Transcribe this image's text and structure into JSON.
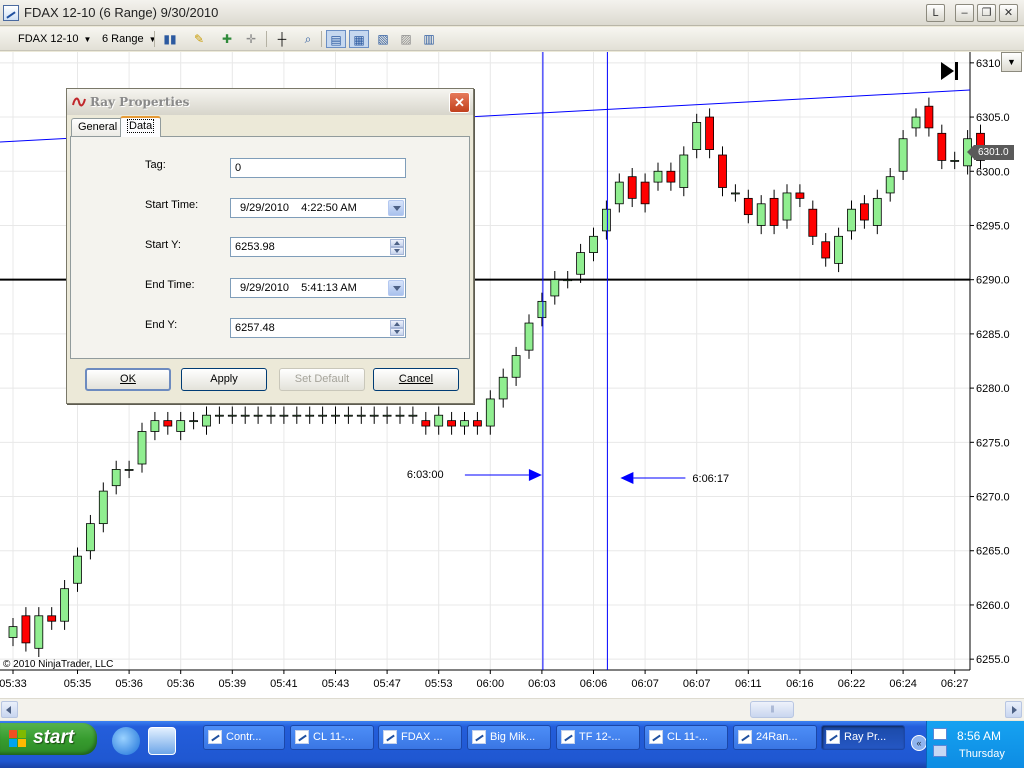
{
  "window": {
    "title": "FDAX 12-10 (6 Range)  9/30/2010",
    "mode_button": "L",
    "minimize": "–",
    "maximize": "❐",
    "close": "✕"
  },
  "toolbar": {
    "instrument": "FDAX 12-10",
    "period": "6 Range"
  },
  "chart": {
    "copyright": "© 2010 NinjaTrader, LLC",
    "last_price_label": "6301.0",
    "scale_menu_icon": "triangle-down-icon",
    "colors": {
      "up_candle": "#90ee90",
      "down_candle": "#ff0000",
      "ray_line": "#0000ff",
      "horizontal_line": "#000000",
      "grid": "#e8e8e8"
    }
  },
  "chart_data": {
    "type": "candlestick",
    "y_axis": {
      "ylim": [
        6254.0,
        6311.0
      ],
      "tick_labels": [
        "6310.0",
        "6305.0",
        "6300.0",
        "6295.0",
        "6290.0",
        "6285.0",
        "6280.0",
        "6275.0",
        "6270.0",
        "6265.0",
        "6260.0",
        "6255.0"
      ],
      "ticks": [
        6310,
        6305,
        6300,
        6295,
        6290,
        6285,
        6280,
        6275,
        6270,
        6265,
        6260,
        6255
      ]
    },
    "x_axis": {
      "tick_labels": [
        "05:33",
        "05:35",
        "05:36",
        "05:36",
        "05:39",
        "05:41",
        "05:43",
        "05:47",
        "05:53",
        "06:00",
        "06:03",
        "06:06",
        "06:07",
        "06:07",
        "06:11",
        "06:16",
        "06:22",
        "06:24",
        "06:27"
      ],
      "tick_bar_index": [
        0,
        5,
        9,
        13,
        17,
        21,
        25,
        29,
        33,
        37,
        41,
        45,
        49,
        53,
        57,
        61,
        65,
        69,
        73
      ]
    },
    "candles": [
      {
        "o": 6257.0,
        "c": 6258.0
      },
      {
        "o": 6259.0,
        "c": 6256.5
      },
      {
        "o": 6256.0,
        "c": 6259.0
      },
      {
        "o": 6259.0,
        "c": 6258.5
      },
      {
        "o": 6258.5,
        "c": 6261.5
      },
      {
        "o": 6262.0,
        "c": 6264.5
      },
      {
        "o": 6265.0,
        "c": 6267.5
      },
      {
        "o": 6267.5,
        "c": 6270.5
      },
      {
        "o": 6271.0,
        "c": 6272.5
      },
      {
        "o": 6272.5,
        "c": 6272.5
      },
      {
        "o": 6273.0,
        "c": 6276.0
      },
      {
        "o": 6276.0,
        "c": 6277.0
      },
      {
        "o": 6277.0,
        "c": 6276.5
      },
      {
        "o": 6276.0,
        "c": 6277.0
      },
      {
        "o": 6277.0,
        "c": 6277.0
      },
      {
        "o": 6276.5,
        "c": 6277.5
      },
      {
        "o": 6277.5,
        "c": 6277.5
      },
      {
        "o": 6277.5,
        "c": 6277.5
      },
      {
        "o": 6277.5,
        "c": 6277.5
      },
      {
        "o": 6277.5,
        "c": 6277.5
      },
      {
        "o": 6277.5,
        "c": 6277.5
      },
      {
        "o": 6277.5,
        "c": 6277.5
      },
      {
        "o": 6277.5,
        "c": 6277.5
      },
      {
        "o": 6277.5,
        "c": 6277.5
      },
      {
        "o": 6277.5,
        "c": 6277.5
      },
      {
        "o": 6277.5,
        "c": 6277.5
      },
      {
        "o": 6277.5,
        "c": 6277.5
      },
      {
        "o": 6277.5,
        "c": 6277.5
      },
      {
        "o": 6277.5,
        "c": 6277.5
      },
      {
        "o": 6277.5,
        "c": 6277.5
      },
      {
        "o": 6277.5,
        "c": 6277.5
      },
      {
        "o": 6277.5,
        "c": 6277.5
      },
      {
        "o": 6277.0,
        "c": 6276.5
      },
      {
        "o": 6276.5,
        "c": 6277.5
      },
      {
        "o": 6277.0,
        "c": 6276.5
      },
      {
        "o": 6276.5,
        "c": 6277.0
      },
      {
        "o": 6277.0,
        "c": 6276.5
      },
      {
        "o": 6276.5,
        "c": 6279.0
      },
      {
        "o": 6279.0,
        "c": 6281.0
      },
      {
        "o": 6281.0,
        "c": 6283.0
      },
      {
        "o": 6283.5,
        "c": 6286.0
      },
      {
        "o": 6286.5,
        "c": 6288.0
      },
      {
        "o": 6288.5,
        "c": 6290.0
      },
      {
        "o": 6290.0,
        "c": 6290.0
      },
      {
        "o": 6290.5,
        "c": 6292.5
      },
      {
        "o": 6292.5,
        "c": 6294.0
      },
      {
        "o": 6294.5,
        "c": 6296.5
      },
      {
        "o": 6297.0,
        "c": 6299.0
      },
      {
        "o": 6299.5,
        "c": 6297.5
      },
      {
        "o": 6299.0,
        "c": 6297.0
      },
      {
        "o": 6299.0,
        "c": 6300.0
      },
      {
        "o": 6300.0,
        "c": 6299.0
      },
      {
        "o": 6298.5,
        "c": 6301.5
      },
      {
        "o": 6302.0,
        "c": 6304.5
      },
      {
        "o": 6305.0,
        "c": 6302.0
      },
      {
        "o": 6301.5,
        "c": 6298.5
      },
      {
        "o": 6298.0,
        "c": 6298.0
      },
      {
        "o": 6297.5,
        "c": 6296.0
      },
      {
        "o": 6295.0,
        "c": 6297.0
      },
      {
        "o": 6297.5,
        "c": 6295.0
      },
      {
        "o": 6295.5,
        "c": 6298.0
      },
      {
        "o": 6298.0,
        "c": 6297.5
      },
      {
        "o": 6296.5,
        "c": 6294.0
      },
      {
        "o": 6293.5,
        "c": 6292.0
      },
      {
        "o": 6291.5,
        "c": 6294.0
      },
      {
        "o": 6294.5,
        "c": 6296.5
      },
      {
        "o": 6297.0,
        "c": 6295.5
      },
      {
        "o": 6295.0,
        "c": 6297.5
      },
      {
        "o": 6298.0,
        "c": 6299.5
      },
      {
        "o": 6300.0,
        "c": 6303.0
      },
      {
        "o": 6304.0,
        "c": 6305.0
      },
      {
        "o": 6306.0,
        "c": 6304.0
      },
      {
        "o": 6303.5,
        "c": 6301.0
      },
      {
        "o": 6301.0,
        "c": 6301.0
      },
      {
        "o": 6300.5,
        "c": 6303.0
      },
      {
        "o": 6303.5,
        "c": 6301.0
      }
    ],
    "horizontal_line": 6290.0,
    "vertical_lines": [
      {
        "bar_index": 41,
        "label": "6:03:00"
      },
      {
        "bar_index": 46,
        "label": "6:06:17"
      }
    ],
    "ray": {
      "start_y": 6253.98,
      "end_y": 6257.48
    }
  },
  "dialog": {
    "title": "Ray Properties",
    "tabs": [
      {
        "label": "General"
      },
      {
        "label": "Data"
      }
    ],
    "fields": {
      "tag": {
        "label": "Tag:",
        "value": "0"
      },
      "start_time": {
        "label": "Start Time:",
        "value": "9/29/2010    4:22:50 AM"
      },
      "start_y": {
        "label": "Start Y:",
        "value": "6253.98"
      },
      "end_time": {
        "label": "End Time:",
        "value": "9/29/2010    5:41:13 AM"
      },
      "end_y": {
        "label": "End Y:",
        "value": "6257.48"
      }
    },
    "buttons": {
      "ok": "OK",
      "apply": "Apply",
      "set_default": "Set Default",
      "cancel": "Cancel"
    }
  },
  "taskbar": {
    "start_label": "start",
    "items": [
      {
        "label": "Contr...",
        "icon": "ninjatrader-icon"
      },
      {
        "label": "CL 11-...",
        "icon": "chart-icon"
      },
      {
        "label": "FDAX ...",
        "icon": "chart-icon"
      },
      {
        "label": "Big Mik...",
        "icon": "ie-icon"
      },
      {
        "label": "TF 12-...",
        "icon": "chart-icon"
      },
      {
        "label": "CL 11-...",
        "icon": "chart-icon"
      },
      {
        "label": "24Ran...",
        "icon": "folder-icon"
      },
      {
        "label": "Ray Pr...",
        "icon": "ninjatrader-icon",
        "active": true
      }
    ],
    "clock": "8:56 AM",
    "day": "Thursday"
  }
}
